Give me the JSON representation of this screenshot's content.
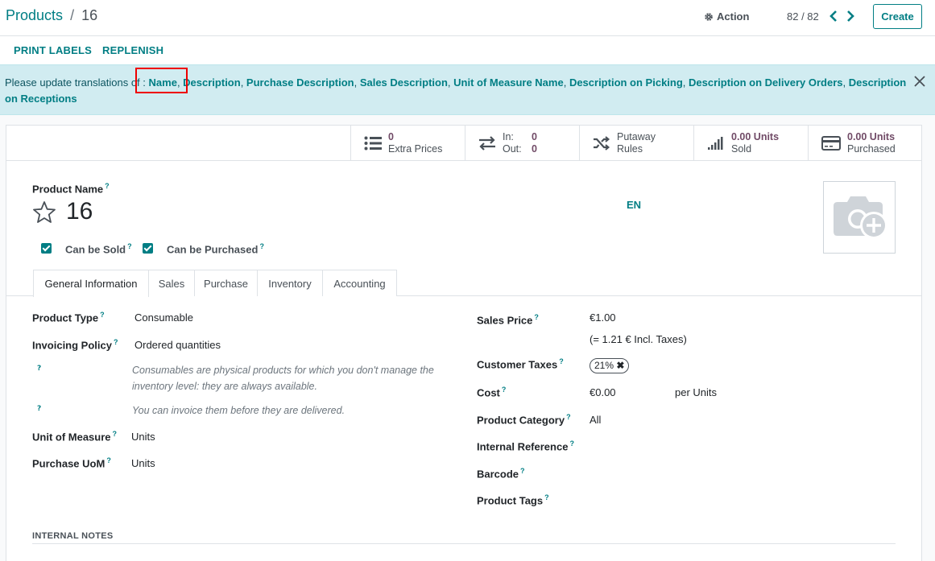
{
  "breadcrumb": {
    "parent": "Products",
    "separator": "/",
    "current": "16"
  },
  "control": {
    "action_label": "Action",
    "pager": "82 / 82",
    "create_label": "Create"
  },
  "header_buttons": {
    "print_labels": "PRINT LABELS",
    "replenish": "REPLENISH"
  },
  "alert": {
    "prefix": "Please update translations of : ",
    "fields": [
      "Name",
      "Description",
      "Purchase Description",
      "Sales Description",
      "Unit of Measure Name",
      "Description on Picking",
      "Description on Delivery Orders",
      "Description on Receptions"
    ]
  },
  "stat_buttons": {
    "extra_prices": {
      "value": "0",
      "label": "Extra Prices"
    },
    "in_out": {
      "in_label": "In:",
      "in_value": "0",
      "out_label": "Out:",
      "out_value": "0"
    },
    "putaway": {
      "line1": "Putaway",
      "line2": "Rules"
    },
    "sold": {
      "value": "0.00 Units",
      "label": "Sold"
    },
    "purchased": {
      "value": "0.00 Units",
      "label": "Purchased"
    }
  },
  "product": {
    "name_label": "Product Name",
    "name": "16",
    "lang": "EN",
    "can_be_sold": "Can be Sold",
    "can_be_purchased": "Can be Purchased"
  },
  "help_marker": "?",
  "tabs": [
    "General Information",
    "Sales",
    "Purchase",
    "Inventory",
    "Accounting"
  ],
  "general": {
    "product_type_label": "Product Type",
    "product_type": "Consumable",
    "invoicing_policy_label": "Invoicing Policy",
    "invoicing_policy": "Ordered quantities",
    "help_consumable": "Consumables are physical products for which you don't manage the inventory level: they are always available.",
    "help_invoice": "You can invoice them before they are delivered.",
    "uom_label": "Unit of Measure",
    "uom": "Units",
    "purchase_uom_label": "Purchase UoM",
    "purchase_uom": "Units",
    "sales_price_label": "Sales Price",
    "sales_price": "€1.00",
    "incl_taxes": "(= 1.21 € Incl. Taxes)",
    "customer_taxes_label": "Customer Taxes",
    "customer_tax_tag": "21%",
    "cost_label": "Cost",
    "cost": "€0.00",
    "cost_unit": "per Units",
    "category_label": "Product Category",
    "category": "All",
    "internal_ref_label": "Internal Reference",
    "barcode_label": "Barcode",
    "tags_label": "Product Tags"
  },
  "internal_notes": "INTERNAL NOTES",
  "colors": {
    "teal": "#017e84",
    "purple": "#714b67",
    "alert_bg": "#d1ecf1",
    "highlight": "#ee0000"
  },
  "icons": [
    "gear-icon",
    "chevron-left-icon",
    "chevron-right-icon",
    "close-icon",
    "list-icon",
    "arrows-exchange-icon",
    "shuffle-icon",
    "signal-bars-icon",
    "credit-card-icon",
    "star-icon",
    "camera-plus-icon"
  ]
}
